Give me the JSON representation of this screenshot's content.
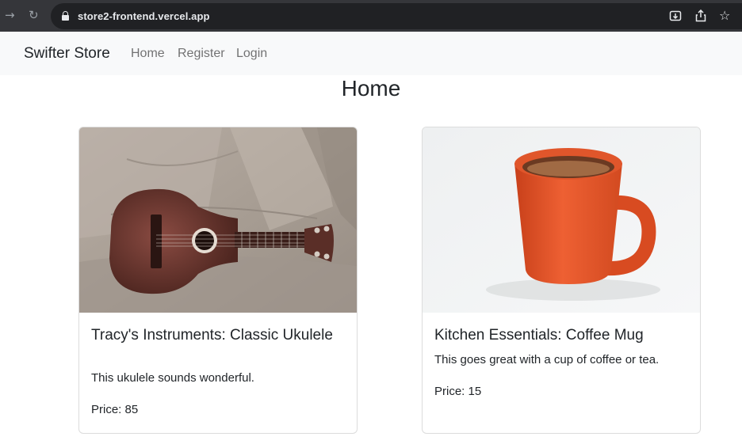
{
  "browser": {
    "url": "store2-frontend.vercel.app",
    "back_icon": "arrow-forward-icon",
    "reload_icon": "reload-icon"
  },
  "navbar": {
    "brand": "Swifter Store",
    "links": [
      "Home",
      "Register",
      "Login"
    ]
  },
  "page": {
    "title": "Home"
  },
  "products": [
    {
      "title": "Tracy's Instruments: Classic Ukulele",
      "description": "This ukulele sounds wonderful.",
      "price_label": "Price: 85",
      "image": "ukulele-on-couch"
    },
    {
      "title": "Kitchen Essentials: Coffee Mug",
      "description": "This goes great with a cup of coffee or tea.",
      "price_label": "Price: 15",
      "image": "orange-coffee-mug"
    }
  ]
}
